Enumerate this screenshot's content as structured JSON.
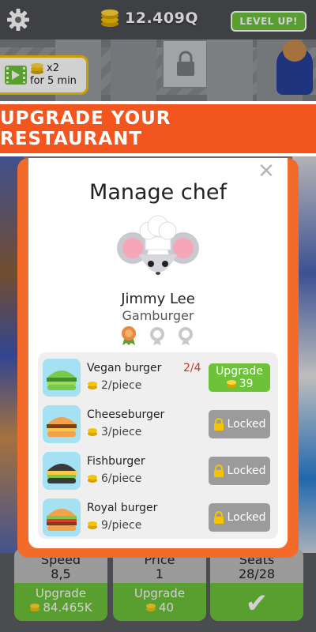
{
  "hud": {
    "coins": "12.409Q",
    "level_up": "LEVEL UP!"
  },
  "boost": {
    "multiplier": "x2",
    "duration": "for 5 min"
  },
  "banner": {
    "text": "UPGRADE YOUR RESTAURANT"
  },
  "modal": {
    "title": "Manage chef",
    "chef_name": "Jimmy Lee",
    "chef_role": "Gamburger",
    "medals": [
      "earned",
      "empty",
      "empty"
    ],
    "recipes": [
      {
        "name": "Vegan burger",
        "price": "2/piece",
        "progress": "2/4",
        "action": "Upgrade",
        "cost": "39",
        "state": "upgrade"
      },
      {
        "name": "Cheeseburger",
        "price": "3/piece",
        "progress": "",
        "action": "Locked",
        "state": "locked"
      },
      {
        "name": "Fishburger",
        "price": "6/piece",
        "progress": "",
        "action": "Locked",
        "state": "locked"
      },
      {
        "name": "Royal burger",
        "price": "9/piece",
        "progress": "",
        "action": "Locked",
        "state": "locked"
      }
    ]
  },
  "stats": [
    {
      "label": "Speed",
      "value": "8,5",
      "action": "Upgrade",
      "cost": "84.465K"
    },
    {
      "label": "Price",
      "value": "1",
      "action": "Upgrade",
      "cost": "40"
    },
    {
      "label": "Seats",
      "value": "28/28",
      "action": "",
      "cost": ""
    }
  ],
  "colors": {
    "accent_orange": "#f2551e",
    "green": "#6dc23a",
    "locked_gray": "#9b9b9b",
    "coin_gold": "#f5c400"
  }
}
